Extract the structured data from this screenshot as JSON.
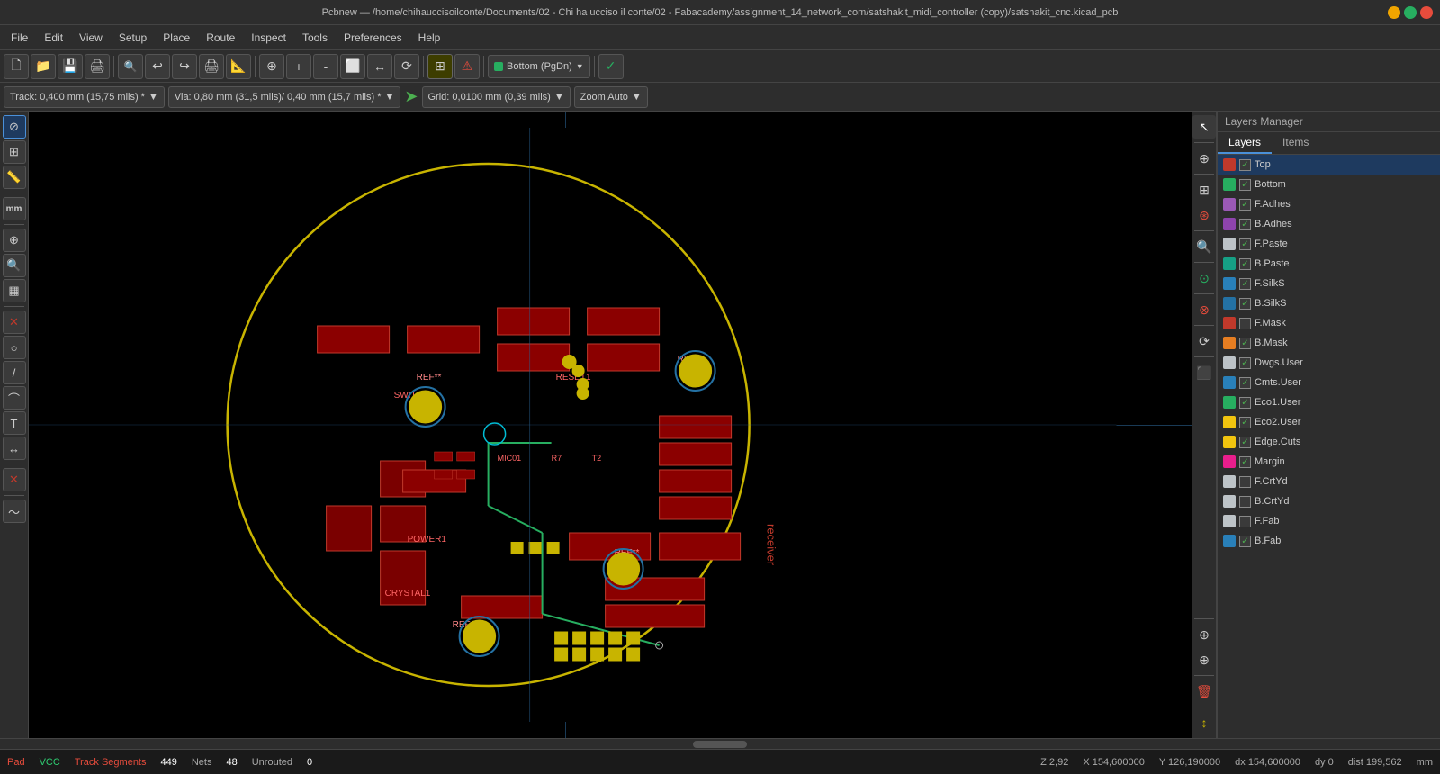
{
  "titlebar": {
    "title": "Pcbnew — /home/chihauccisoilconte/Documents/02 - Chi ha ucciso il conte/02 - Fabacademy/assignment_14_network_com/satshakit_midi_controller (copy)/satshakit_cnc.kicad_pcb"
  },
  "menubar": {
    "items": [
      "File",
      "Edit",
      "View",
      "Setup",
      "Place",
      "Route",
      "Inspect",
      "Tools",
      "Preferences",
      "Help"
    ]
  },
  "toolbar": {
    "layer_dropdown": "Bottom (PgDn)",
    "track_label": "Track: 0,400 mm (15,75 mils) *",
    "via_label": "Via: 0,80 mm (31,5 mils)/ 0,40 mm (15,7 mils) *",
    "grid_label": "Grid: 0,0100 mm (0,39 mils)",
    "zoom_label": "Zoom Auto"
  },
  "layers_manager": {
    "title": "Layers Manager",
    "tabs": [
      "Layers",
      "Items"
    ],
    "active_tab": "Layers",
    "layers": [
      {
        "name": "Top",
        "color": "#c0392b",
        "checked": true,
        "selected": true
      },
      {
        "name": "Bottom",
        "color": "#27ae60",
        "checked": true
      },
      {
        "name": "F.Adhes",
        "color": "#9b59b6",
        "checked": true
      },
      {
        "name": "B.Adhes",
        "color": "#8e44ad",
        "checked": true
      },
      {
        "name": "F.Paste",
        "color": "#bdc3c7",
        "checked": true
      },
      {
        "name": "B.Paste",
        "color": "#16a085",
        "checked": true
      },
      {
        "name": "F.SilkS",
        "color": "#2980b9",
        "checked": true
      },
      {
        "name": "B.SilkS",
        "color": "#2471a3",
        "checked": true
      },
      {
        "name": "F.Mask",
        "color": "#c0392b",
        "checked": false
      },
      {
        "name": "B.Mask",
        "color": "#e67e22",
        "checked": true
      },
      {
        "name": "Dwgs.User",
        "color": "#bdc3c7",
        "checked": true
      },
      {
        "name": "Cmts.User",
        "color": "#2980b9",
        "checked": true
      },
      {
        "name": "Eco1.User",
        "color": "#27ae60",
        "checked": true
      },
      {
        "name": "Eco2.User",
        "color": "#f1c40f",
        "checked": true
      },
      {
        "name": "Edge.Cuts",
        "color": "#f1c40f",
        "checked": true
      },
      {
        "name": "Margin",
        "color": "#e91e8c",
        "checked": true
      },
      {
        "name": "F.CrtYd",
        "color": "#bdc3c7",
        "checked": false
      },
      {
        "name": "B.CrtYd",
        "color": "#bdc3c7",
        "checked": false
      },
      {
        "name": "F.Fab",
        "color": "#bdc3c7",
        "checked": false
      },
      {
        "name": "B.Fab",
        "color": "#2980b9",
        "checked": true
      }
    ]
  },
  "statusbar": {
    "pad_label": "Pad",
    "pad_val": "VCC",
    "track_label": "Track Segments",
    "track_val": "449",
    "nets_label": "Nets",
    "nets_val": "48",
    "unrouted_label": "Unrouted",
    "unrouted_val": "0",
    "coords": "Z 2,92",
    "x_coord": "X 154,600000",
    "y_coord": "Y 126,190000",
    "dx": "dx 154,600000",
    "dy": "dy 0",
    "dist": "dist 199,562",
    "unit": "mm"
  }
}
